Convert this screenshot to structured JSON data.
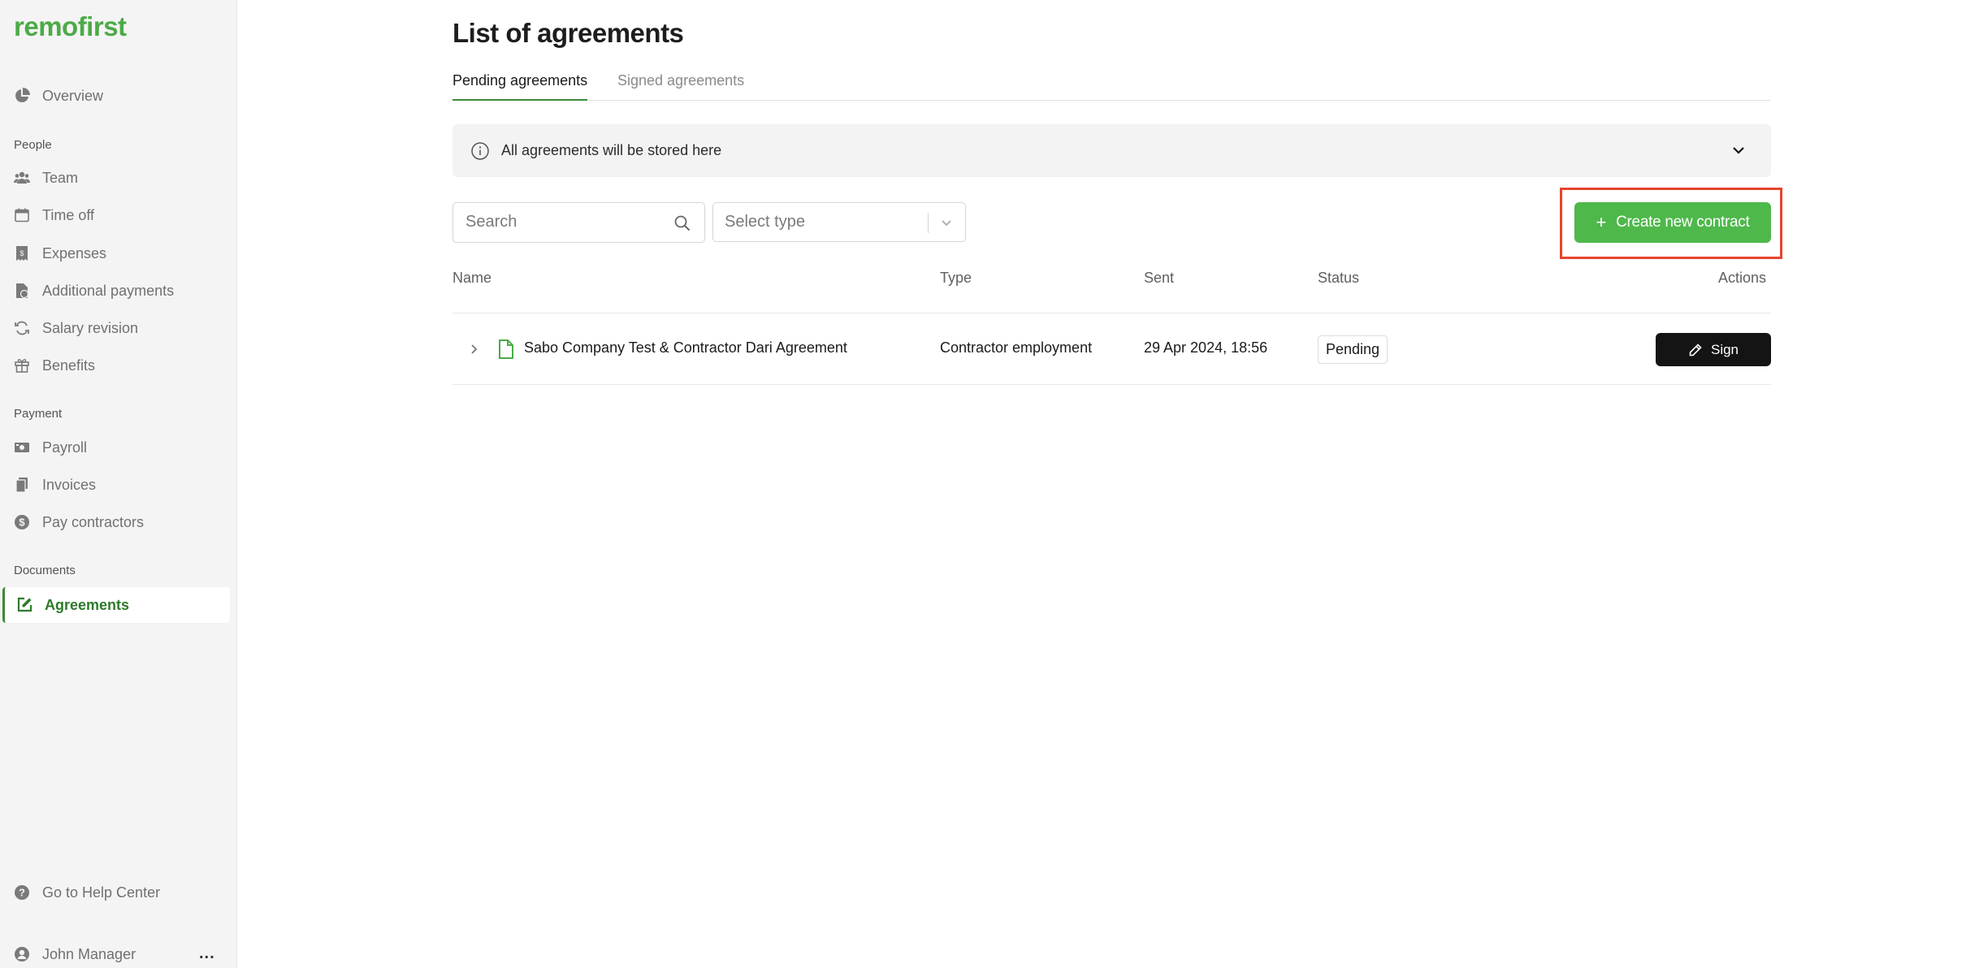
{
  "app": {
    "logo": "remofirst"
  },
  "sidebar": {
    "overview": "Overview",
    "sections": {
      "people": "People",
      "payment": "Payment",
      "documents": "Documents"
    },
    "people_items": [
      "Team",
      "Time off",
      "Expenses",
      "Additional payments",
      "Salary revision",
      "Benefits"
    ],
    "payment_items": [
      "Payroll",
      "Invoices",
      "Pay contractors"
    ],
    "documents_items": [
      "Agreements"
    ],
    "help": "Go to Help Center",
    "user": "John Manager",
    "more": "..."
  },
  "main": {
    "title": "List of agreements",
    "tabs": [
      {
        "label": "Pending agreements",
        "active": true
      },
      {
        "label": "Signed agreements",
        "active": false
      }
    ],
    "info_banner": "All agreements will be stored here",
    "search": {
      "placeholder": "Search",
      "value": ""
    },
    "type_select": {
      "placeholder": "Select type"
    },
    "create_button": "Create new contract",
    "table": {
      "headers": [
        "Name",
        "Type",
        "Sent",
        "Status",
        "Actions"
      ],
      "rows": [
        {
          "name": "Sabo Company Test & Contractor Dari Agreement",
          "type": "Contractor employment",
          "sent": "29 Apr 2024, 18:56",
          "status": "Pending",
          "action": "Sign"
        }
      ]
    }
  },
  "colors": {
    "brand_green": "#4caa47",
    "button_green": "#4eb84a",
    "highlight_red": "#e6442d",
    "sign_button": "#141414"
  }
}
